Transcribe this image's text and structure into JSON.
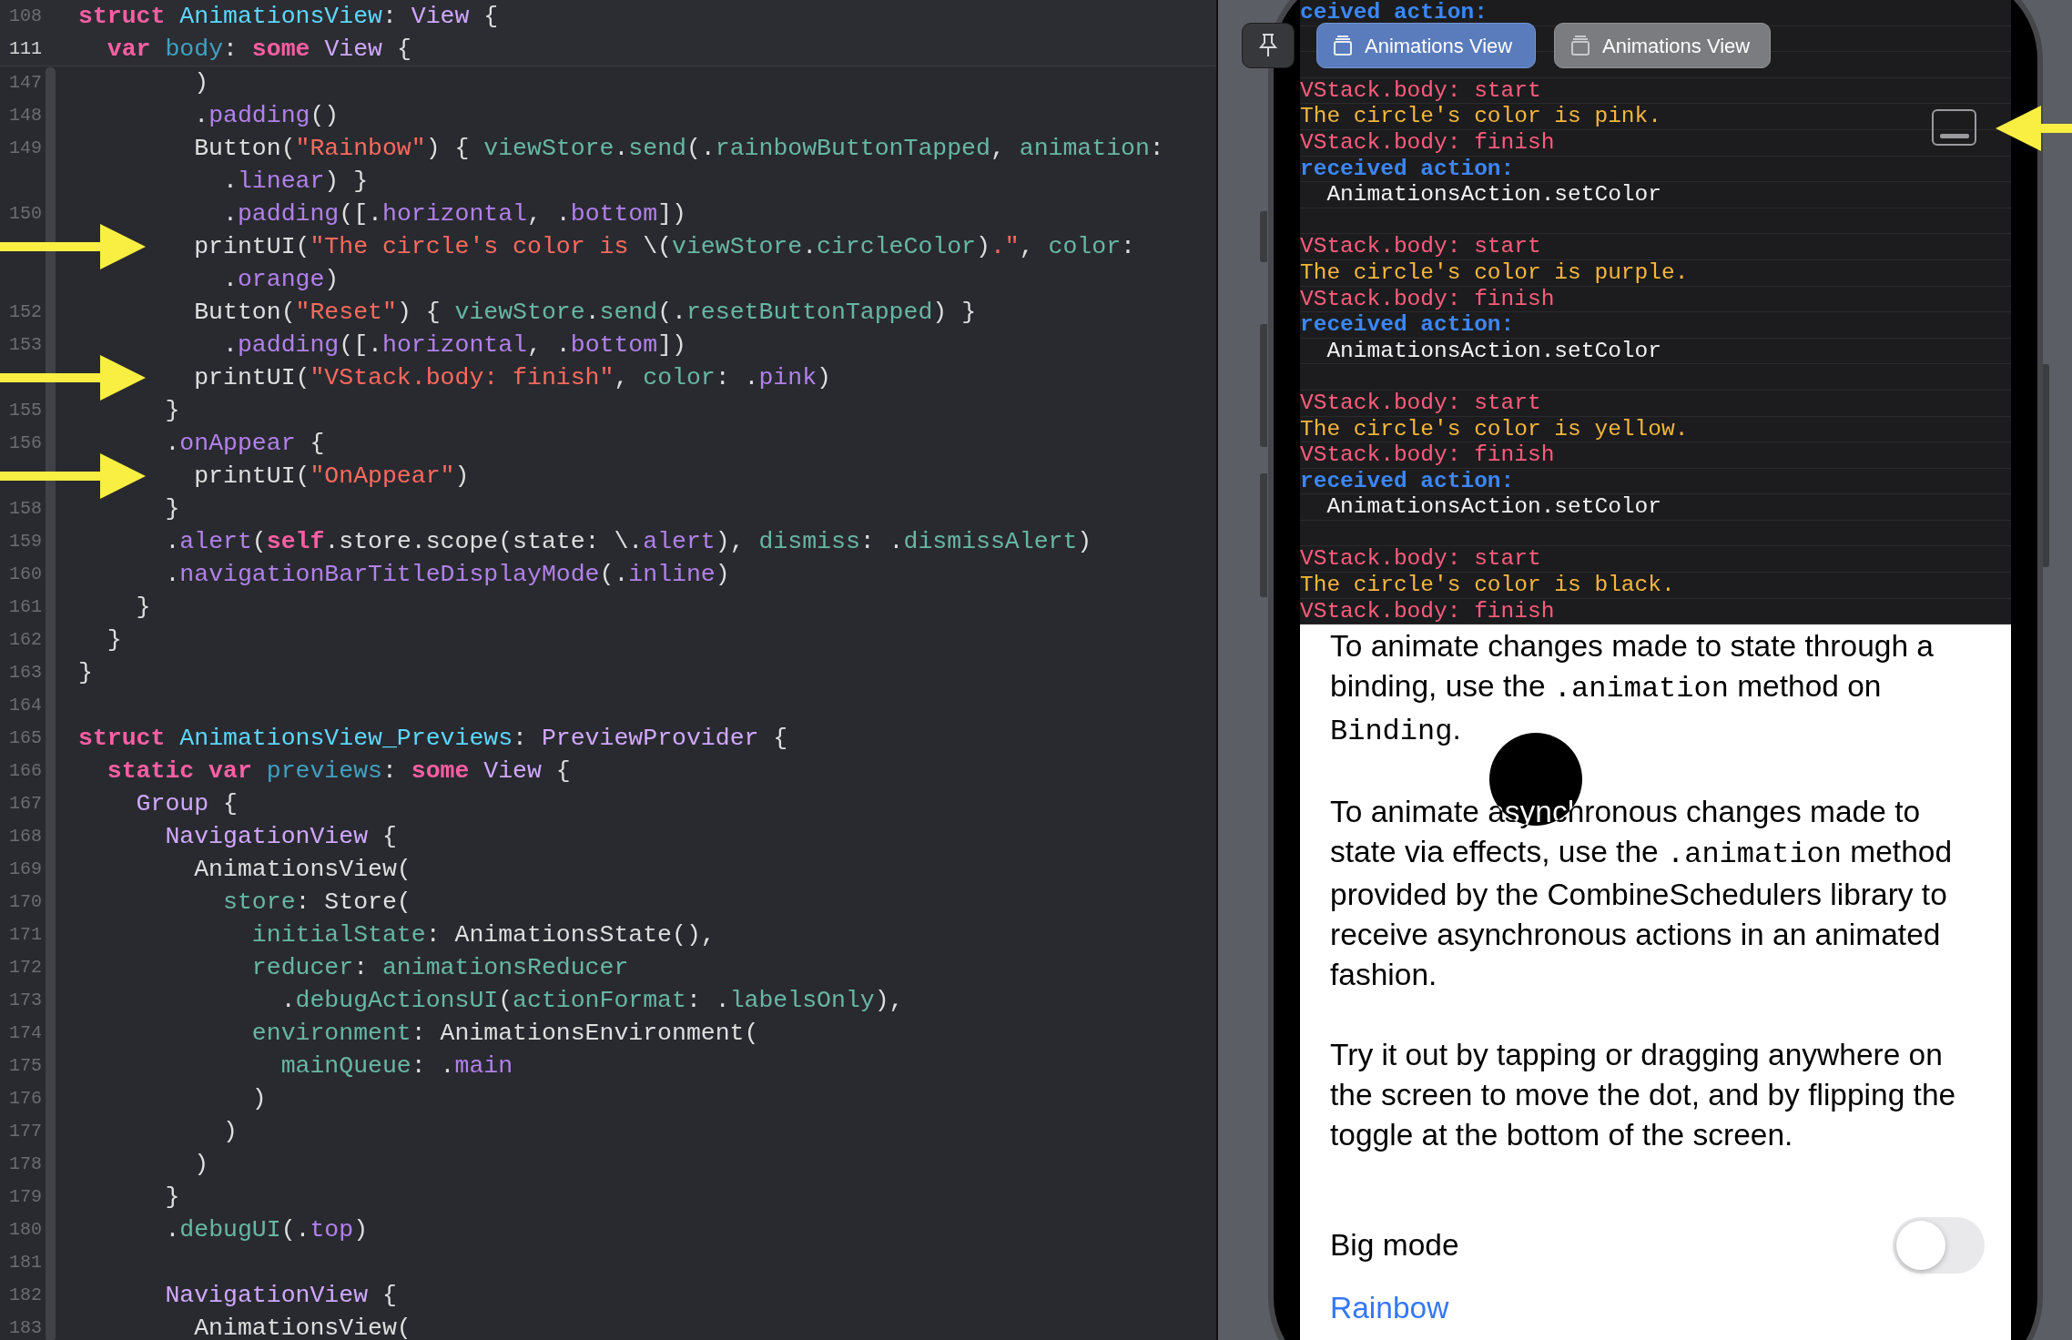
{
  "editor": {
    "sticky_header": [
      {
        "number": "108",
        "code": [
          {
            "text": "struct ",
            "kind": "kw"
          },
          {
            "text": "AnimationsView",
            "kind": "decl"
          },
          {
            "text": ": ",
            "kind": "plain"
          },
          {
            "text": "View",
            "kind": "type"
          },
          {
            "text": " {",
            "kind": "plain"
          }
        ]
      },
      {
        "number": "111",
        "code": [
          {
            "text": "  var ",
            "kind": "kw"
          },
          {
            "text": "body",
            "kind": "declother"
          },
          {
            "text": ": ",
            "kind": "plain"
          },
          {
            "text": "some ",
            "kind": "kw"
          },
          {
            "text": "View",
            "kind": "type"
          },
          {
            "text": " {",
            "kind": "plain"
          }
        ]
      }
    ],
    "lines": [
      {
        "number": "147",
        "code": [
          {
            "text": "        )",
            "kind": "plain"
          }
        ]
      },
      {
        "number": "148",
        "code": [
          {
            "text": "        .",
            "kind": "plain"
          },
          {
            "text": "padding",
            "kind": "sys"
          },
          {
            "text": "()",
            "kind": "plain"
          }
        ]
      },
      {
        "number": "149",
        "code": [
          {
            "text": "        Button(",
            "kind": "plain"
          },
          {
            "text": "\"Rainbow\"",
            "kind": "str"
          },
          {
            "text": ") { ",
            "kind": "plain"
          },
          {
            "text": "viewStore",
            "kind": "proj"
          },
          {
            "text": ".",
            "kind": "plain"
          },
          {
            "text": "send",
            "kind": "proj"
          },
          {
            "text": "(.",
            "kind": "plain"
          },
          {
            "text": "rainbowButtonTapped",
            "kind": "proj"
          },
          {
            "text": ", ",
            "kind": "plain"
          },
          {
            "text": "animation",
            "kind": "proj"
          },
          {
            "text": ":",
            "kind": "plain"
          }
        ]
      },
      {
        "code": [
          {
            "text": "          .",
            "kind": "plain"
          },
          {
            "text": "linear",
            "kind": "sys"
          },
          {
            "text": ") }",
            "kind": "plain"
          }
        ]
      },
      {
        "number": "150",
        "code": [
          {
            "text": "          .",
            "kind": "plain"
          },
          {
            "text": "padding",
            "kind": "sys"
          },
          {
            "text": "([.",
            "kind": "plain"
          },
          {
            "text": "horizontal",
            "kind": "sys"
          },
          {
            "text": ", .",
            "kind": "plain"
          },
          {
            "text": "bottom",
            "kind": "sys"
          },
          {
            "text": "])",
            "kind": "plain"
          }
        ]
      },
      {
        "arrow": true,
        "code": [
          {
            "text": "        printUI(",
            "kind": "plain"
          },
          {
            "text": "\"The circle's color is ",
            "kind": "str"
          },
          {
            "text": "\\(",
            "kind": "plain"
          },
          {
            "text": "viewStore",
            "kind": "proj"
          },
          {
            "text": ".",
            "kind": "plain"
          },
          {
            "text": "circleColor",
            "kind": "proj"
          },
          {
            "text": ")",
            "kind": "plain"
          },
          {
            "text": ".\"",
            "kind": "str"
          },
          {
            "text": ", ",
            "kind": "plain"
          },
          {
            "text": "color",
            "kind": "proj"
          },
          {
            "text": ":",
            "kind": "plain"
          }
        ]
      },
      {
        "code": [
          {
            "text": "          .",
            "kind": "plain"
          },
          {
            "text": "orange",
            "kind": "sys"
          },
          {
            "text": ")",
            "kind": "plain"
          }
        ]
      },
      {
        "number": "152",
        "code": [
          {
            "text": "        Button(",
            "kind": "plain"
          },
          {
            "text": "\"Reset\"",
            "kind": "str"
          },
          {
            "text": ") { ",
            "kind": "plain"
          },
          {
            "text": "viewStore",
            "kind": "proj"
          },
          {
            "text": ".",
            "kind": "plain"
          },
          {
            "text": "send",
            "kind": "proj"
          },
          {
            "text": "(.",
            "kind": "plain"
          },
          {
            "text": "resetButtonTapped",
            "kind": "proj"
          },
          {
            "text": ") }",
            "kind": "plain"
          }
        ]
      },
      {
        "number": "153",
        "code": [
          {
            "text": "          .",
            "kind": "plain"
          },
          {
            "text": "padding",
            "kind": "sys"
          },
          {
            "text": "([.",
            "kind": "plain"
          },
          {
            "text": "horizontal",
            "kind": "sys"
          },
          {
            "text": ", .",
            "kind": "plain"
          },
          {
            "text": "bottom",
            "kind": "sys"
          },
          {
            "text": "])",
            "kind": "plain"
          }
        ]
      },
      {
        "arrow": true,
        "code": [
          {
            "text": "        printUI(",
            "kind": "plain"
          },
          {
            "text": "\"VStack.body: finish\"",
            "kind": "str"
          },
          {
            "text": ", ",
            "kind": "plain"
          },
          {
            "text": "color",
            "kind": "proj"
          },
          {
            "text": ": .",
            "kind": "plain"
          },
          {
            "text": "pink",
            "kind": "sys"
          },
          {
            "text": ")",
            "kind": "plain"
          }
        ]
      },
      {
        "number": "155",
        "code": [
          {
            "text": "      }",
            "kind": "plain"
          }
        ]
      },
      {
        "number": "156",
        "code": [
          {
            "text": "      .",
            "kind": "plain"
          },
          {
            "text": "onAppear",
            "kind": "sys"
          },
          {
            "text": " {",
            "kind": "plain"
          }
        ]
      },
      {
        "arrow": true,
        "code": [
          {
            "text": "        printUI(",
            "kind": "plain"
          },
          {
            "text": "\"OnAppear\"",
            "kind": "str"
          },
          {
            "text": ")",
            "kind": "plain"
          }
        ]
      },
      {
        "number": "158",
        "code": [
          {
            "text": "      }",
            "kind": "plain"
          }
        ]
      },
      {
        "number": "159",
        "code": [
          {
            "text": "      .",
            "kind": "plain"
          },
          {
            "text": "alert",
            "kind": "sys"
          },
          {
            "text": "(",
            "kind": "plain"
          },
          {
            "text": "self",
            "kind": "kw"
          },
          {
            "text": ".store.scope(state: \\.",
            "kind": "plain"
          },
          {
            "text": "alert",
            "kind": "sys"
          },
          {
            "text": "), ",
            "kind": "plain"
          },
          {
            "text": "dismiss",
            "kind": "proj"
          },
          {
            "text": ": .",
            "kind": "plain"
          },
          {
            "text": "dismissAlert",
            "kind": "proj"
          },
          {
            "text": ")",
            "kind": "plain"
          }
        ]
      },
      {
        "number": "160",
        "code": [
          {
            "text": "      .",
            "kind": "plain"
          },
          {
            "text": "navigationBarTitleDisplayMode",
            "kind": "sys"
          },
          {
            "text": "(.",
            "kind": "plain"
          },
          {
            "text": "inline",
            "kind": "sys"
          },
          {
            "text": ")",
            "kind": "plain"
          }
        ]
      },
      {
        "number": "161",
        "code": [
          {
            "text": "    }",
            "kind": "plain"
          }
        ]
      },
      {
        "number": "162",
        "code": [
          {
            "text": "  }",
            "kind": "plain"
          }
        ]
      },
      {
        "number": "163",
        "code": [
          {
            "text": "}",
            "kind": "plain"
          }
        ]
      },
      {
        "number": "164"
      },
      {
        "number": "165",
        "code": [
          {
            "text": "struct ",
            "kind": "kw"
          },
          {
            "text": "AnimationsView_Previews",
            "kind": "decl"
          },
          {
            "text": ": ",
            "kind": "plain"
          },
          {
            "text": "PreviewProvider",
            "kind": "type"
          },
          {
            "text": " {",
            "kind": "plain"
          }
        ]
      },
      {
        "number": "166",
        "code": [
          {
            "text": "  static var ",
            "kind": "kw"
          },
          {
            "text": "previews",
            "kind": "declother"
          },
          {
            "text": ": ",
            "kind": "plain"
          },
          {
            "text": "some ",
            "kind": "kw"
          },
          {
            "text": "View",
            "kind": "type"
          },
          {
            "text": " {",
            "kind": "plain"
          }
        ]
      },
      {
        "number": "167",
        "code": [
          {
            "text": "    Group",
            "kind": "type"
          },
          {
            "text": " {",
            "kind": "plain"
          }
        ]
      },
      {
        "number": "168",
        "code": [
          {
            "text": "      NavigationView",
            "kind": "type"
          },
          {
            "text": " {",
            "kind": "plain"
          }
        ]
      },
      {
        "number": "169",
        "code": [
          {
            "text": "        AnimationsView(",
            "kind": "plain"
          }
        ]
      },
      {
        "number": "170",
        "code": [
          {
            "text": "          store",
            "kind": "proj"
          },
          {
            "text": ": Store(",
            "kind": "plain"
          }
        ]
      },
      {
        "number": "171",
        "code": [
          {
            "text": "            initialState",
            "kind": "proj"
          },
          {
            "text": ": AnimationsState(),",
            "kind": "plain"
          }
        ]
      },
      {
        "number": "172",
        "code": [
          {
            "text": "            reducer",
            "kind": "proj"
          },
          {
            "text": ": ",
            "kind": "plain"
          },
          {
            "text": "animationsReducer",
            "kind": "proj"
          }
        ]
      },
      {
        "number": "173",
        "code": [
          {
            "text": "              .",
            "kind": "plain"
          },
          {
            "text": "debugActionsUI",
            "kind": "proj"
          },
          {
            "text": "(",
            "kind": "plain"
          },
          {
            "text": "actionFormat",
            "kind": "proj"
          },
          {
            "text": ": .",
            "kind": "plain"
          },
          {
            "text": "labelsOnly",
            "kind": "proj"
          },
          {
            "text": "),",
            "kind": "plain"
          }
        ]
      },
      {
        "number": "174",
        "code": [
          {
            "text": "            environment",
            "kind": "proj"
          },
          {
            "text": ": AnimationsEnvironment(",
            "kind": "plain"
          }
        ]
      },
      {
        "number": "175",
        "code": [
          {
            "text": "              mainQueue",
            "kind": "proj"
          },
          {
            "text": ": .",
            "kind": "plain"
          },
          {
            "text": "main",
            "kind": "sys"
          }
        ]
      },
      {
        "number": "176",
        "code": [
          {
            "text": "            )",
            "kind": "plain"
          }
        ]
      },
      {
        "number": "177",
        "code": [
          {
            "text": "          )",
            "kind": "plain"
          }
        ]
      },
      {
        "number": "178",
        "code": [
          {
            "text": "        )",
            "kind": "plain"
          }
        ]
      },
      {
        "number": "179",
        "code": [
          {
            "text": "      }",
            "kind": "plain"
          }
        ]
      },
      {
        "number": "180",
        "code": [
          {
            "text": "      .",
            "kind": "plain"
          },
          {
            "text": "debugUI",
            "kind": "proj"
          },
          {
            "text": "(.",
            "kind": "plain"
          },
          {
            "text": "top",
            "kind": "sys"
          },
          {
            "text": ")",
            "kind": "plain"
          }
        ]
      },
      {
        "number": "181"
      },
      {
        "number": "182",
        "code": [
          {
            "text": "      NavigationView",
            "kind": "type"
          },
          {
            "text": " {",
            "kind": "plain"
          }
        ]
      },
      {
        "number": "183",
        "code": [
          {
            "text": "        AnimationsView(",
            "kind": "plain"
          }
        ]
      }
    ]
  },
  "preview": {
    "tabs": [
      {
        "label": "Animations View",
        "selected": true
      },
      {
        "label": "Animations View",
        "selected": false
      }
    ],
    "debug_log": [
      {
        "kind": "action_label",
        "text": "ceived action:"
      },
      {
        "kind": "blank"
      },
      {
        "kind": "blank"
      },
      {
        "kind": "print",
        "text": "VStack.body: start",
        "color": "#ff5c7c"
      },
      {
        "kind": "print",
        "text": "The circle's color is pink.",
        "color": "#f6b73c"
      },
      {
        "kind": "print",
        "text": "VStack.body: finish",
        "color": "#ff5c7c"
      },
      {
        "kind": "action_label",
        "text": "received action:"
      },
      {
        "kind": "action",
        "text": "AnimationsAction.setColor"
      },
      {
        "kind": "blank"
      },
      {
        "kind": "print",
        "text": "VStack.body: start",
        "color": "#ff5c7c"
      },
      {
        "kind": "print",
        "text": "The circle's color is purple.",
        "color": "#f6b73c"
      },
      {
        "kind": "print",
        "text": "VStack.body: finish",
        "color": "#ff5c7c"
      },
      {
        "kind": "action_label",
        "text": "received action:"
      },
      {
        "kind": "action",
        "text": "AnimationsAction.setColor"
      },
      {
        "kind": "blank"
      },
      {
        "kind": "print",
        "text": "VStack.body: start",
        "color": "#ff5c7c"
      },
      {
        "kind": "print",
        "text": "The circle's color is yellow.",
        "color": "#f6b73c"
      },
      {
        "kind": "print",
        "text": "VStack.body: finish",
        "color": "#ff5c7c"
      },
      {
        "kind": "action_label",
        "text": "received action:"
      },
      {
        "kind": "action",
        "text": "AnimationsAction.setColor"
      },
      {
        "kind": "blank"
      },
      {
        "kind": "print",
        "text": "VStack.body: start",
        "color": "#ff5c7c"
      },
      {
        "kind": "print",
        "text": "The circle's color is black.",
        "color": "#f6b73c"
      },
      {
        "kind": "print",
        "text": "VStack.body: finish",
        "color": "#ff5c7c"
      }
    ],
    "paragraphs": [
      [
        {
          "text": "To animate changes made to state through a binding, use the ",
          "kind": "text"
        },
        {
          "text": ".animation",
          "kind": "code"
        },
        {
          "text": " method on ",
          "kind": "text"
        },
        {
          "text": "Binding",
          "kind": "code"
        },
        {
          "text": ".",
          "kind": "text"
        }
      ],
      [
        {
          "text": "To animate asynchronous changes made to state via effects, use the ",
          "kind": "text"
        },
        {
          "text": ".animation",
          "kind": "code"
        },
        {
          "text": " method provided by the CombineSchedulers library to receive asynchronous actions in an animated fashion.",
          "kind": "text"
        }
      ],
      [
        {
          "text": "Try it out by tapping or dragging anywhere on the screen to move the dot, and by flipping the toggle at the bottom of the screen.",
          "kind": "text"
        }
      ]
    ],
    "toggle": {
      "label": "Big mode",
      "on": false
    },
    "link": "Rainbow"
  }
}
